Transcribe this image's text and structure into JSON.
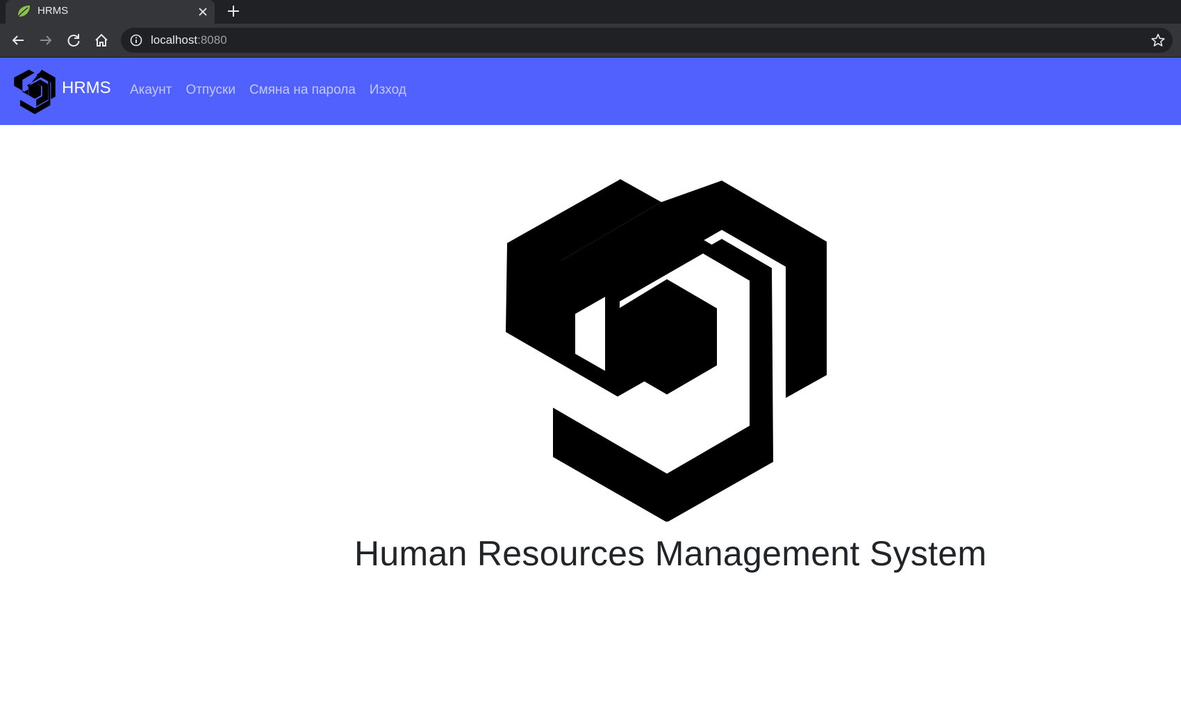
{
  "browser": {
    "tab_title": "HRMS",
    "url_host": "localhost",
    "url_port": ":8080",
    "icons": {
      "favicon": "spring-leaf-icon",
      "close": "close-icon",
      "new_tab": "plus-icon",
      "back": "arrow-left-icon",
      "forward": "arrow-right-icon",
      "reload": "reload-icon",
      "home": "home-icon",
      "site_info": "info-icon",
      "bookmark": "star-icon"
    }
  },
  "navbar": {
    "brand": "HRMS",
    "color": "#5061fe",
    "links": [
      {
        "label": "Акаунт"
      },
      {
        "label": "Отпуски"
      },
      {
        "label": "Смяна на парола"
      },
      {
        "label": "Изход"
      }
    ]
  },
  "main": {
    "title": "Human Resources Management System"
  }
}
